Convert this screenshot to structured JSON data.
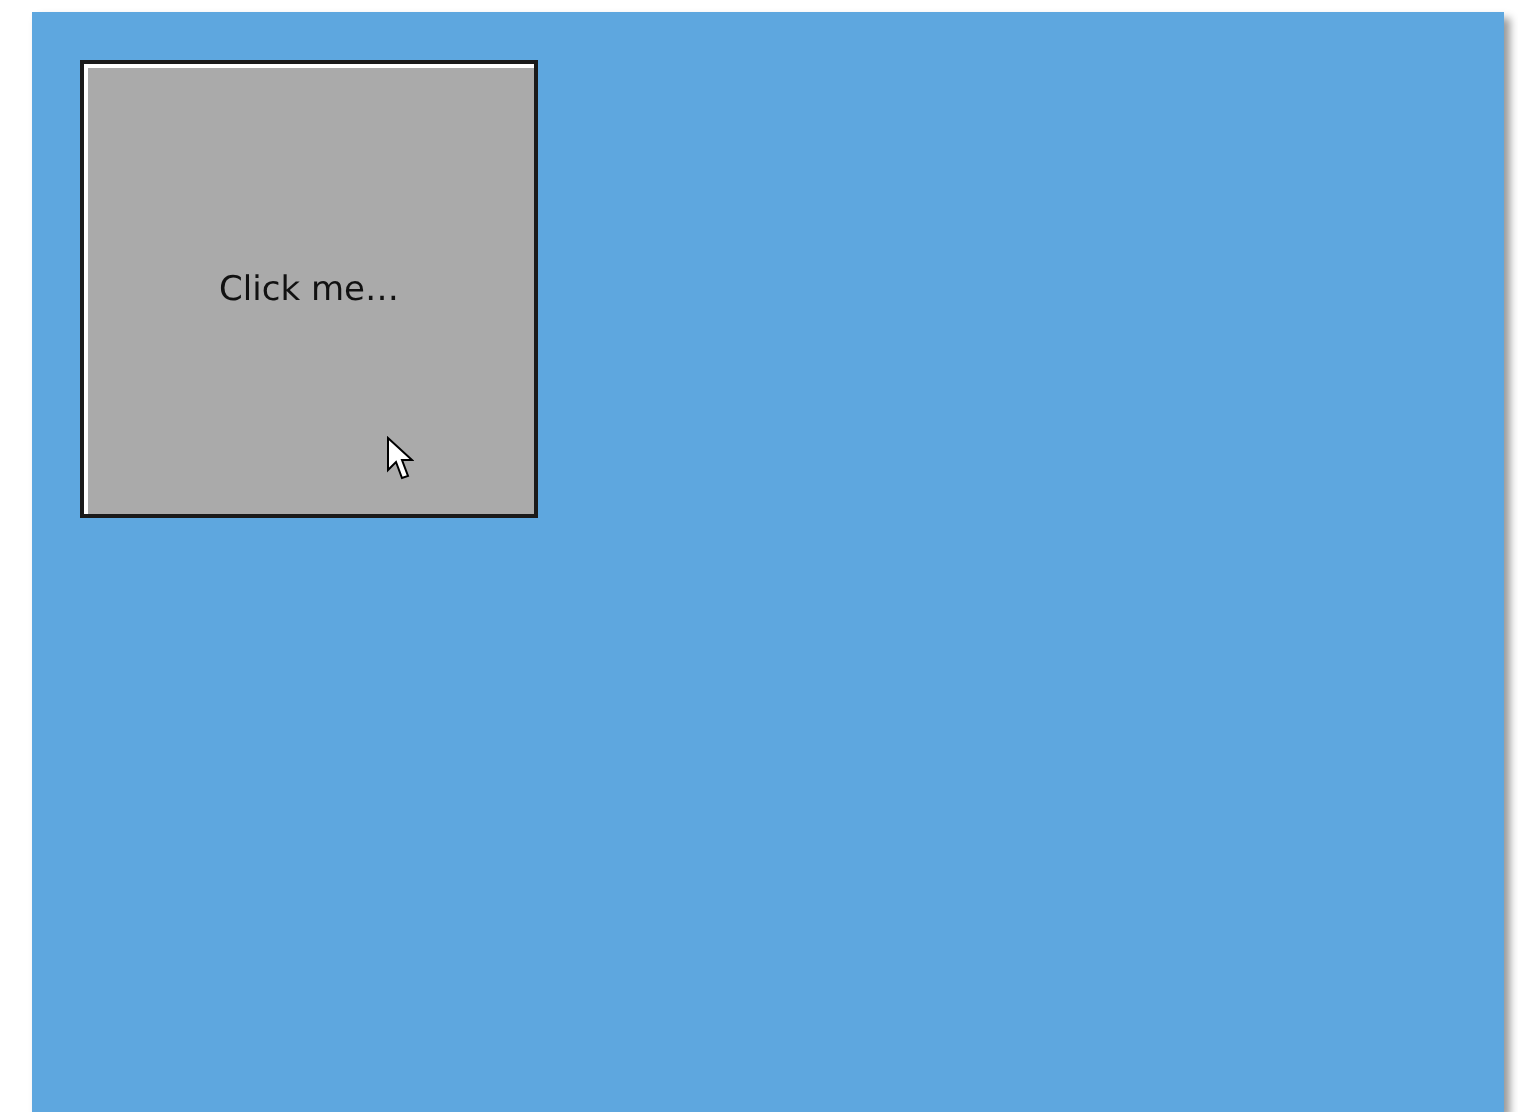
{
  "button": {
    "label": "Click me…"
  }
}
